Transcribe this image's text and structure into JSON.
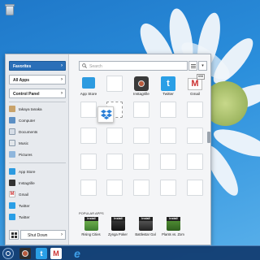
{
  "menu": {
    "dropdowns": [
      "Favorites",
      "All Apps",
      "Control Panel"
    ],
    "places": [
      {
        "label": "takaya tanaka",
        "icon": "user-icon"
      },
      {
        "label": "Computer",
        "icon": "computer-icon"
      },
      {
        "label": "Documents",
        "icon": "documents-icon"
      },
      {
        "label": "Music",
        "icon": "music-icon"
      },
      {
        "label": "Pictures",
        "icon": "pictures-icon"
      }
    ],
    "pinned": [
      {
        "label": "App Store",
        "icon": "app-store-icon"
      },
      {
        "label": "Instagrille",
        "icon": "instagrille-icon"
      },
      {
        "label": "Gmail",
        "icon": "gmail-icon"
      },
      {
        "label": "Twitter",
        "icon": "twitter-icon"
      },
      {
        "label": "Twitter",
        "icon": "twitter-icon"
      }
    ],
    "shutdown_label": "Shut Down"
  },
  "search": {
    "placeholder": "Search"
  },
  "tiles": [
    {
      "label": "App Store",
      "icon": "app-store-icon"
    },
    {
      "label": "Instagrille",
      "icon": "instagrille-icon"
    },
    {
      "label": "Twitter",
      "icon": "twitter-icon"
    },
    {
      "label": "Gmail",
      "icon": "gmail-icon",
      "badge": "608"
    }
  ],
  "popular": {
    "heading": "POPULAR APPS",
    "install_label": "Install",
    "apps": [
      {
        "label": "Rising Cities"
      },
      {
        "label": "Zynga Poker"
      },
      {
        "label": "Battlestar Gal"
      },
      {
        "label": "Plants vs. Zom"
      }
    ]
  },
  "colors": {
    "accent": "#2a6fb8",
    "taskbar": "#103a6e",
    "desktop": "#2b8fdc"
  }
}
